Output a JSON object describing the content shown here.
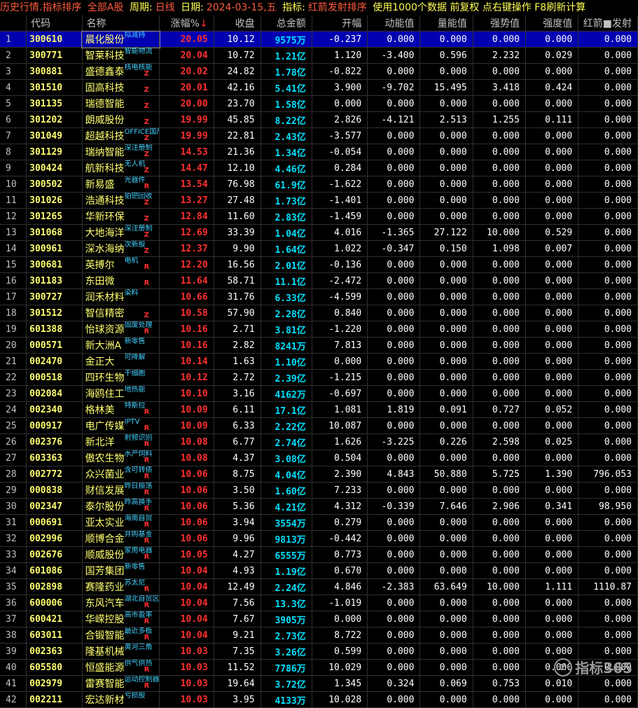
{
  "title": {
    "main": "历史行情.指标排序",
    "market": "全部A股",
    "period_label": "周期:",
    "period_value": "日线",
    "date_label": "日期:",
    "date_value": "2024-03-15,五",
    "indicator_label": "指标:",
    "indicator_value": "红箭发射排序",
    "note": "使用1000个数据 前复权 点右键操作 F8刷新计算"
  },
  "columns": [
    "",
    "代码",
    "名称",
    "涨幅%",
    "收盘",
    "总金额",
    "开幅",
    "动能值",
    "量能值",
    "强势值",
    "强度值",
    "红箭■发射"
  ],
  "sort_arrow": "↓",
  "rows": [
    {
      "i": "1",
      "code": "300610",
      "name": "晨化股份",
      "tag": "拟减持",
      "mark": "",
      "chg": "20.05",
      "close": "10.12",
      "amt": "9575",
      "unit": "万",
      "open": "-0.237",
      "dn": "0.000",
      "ln": "0.000",
      "qs": "0.000",
      "qd": "0.000",
      "hj": "0.000"
    },
    {
      "i": "2",
      "code": "300771",
      "name": "智莱科技",
      "tag": "智能物流",
      "mark": "",
      "chg": "20.04",
      "close": "10.72",
      "amt": "1.21",
      "unit": "亿",
      "open": "1.120",
      "dn": "-3.400",
      "ln": "0.596",
      "qs": "2.232",
      "qd": "0.029",
      "hj": "0.000"
    },
    {
      "i": "3",
      "code": "300881",
      "name": "盛德鑫泰",
      "tag": "核电核能",
      "mark": "Z",
      "chg": "20.02",
      "close": "24.82",
      "amt": "1.78",
      "unit": "亿",
      "open": "-0.822",
      "dn": "0.000",
      "ln": "0.000",
      "qs": "0.000",
      "qd": "0.000",
      "hj": "0.000"
    },
    {
      "i": "4",
      "code": "301510",
      "name": "固高科技",
      "tag": "",
      "mark": "Z",
      "chg": "20.01",
      "close": "42.16",
      "amt": "5.41",
      "unit": "亿",
      "open": "3.900",
      "dn": "-9.702",
      "ln": "15.495",
      "qs": "3.418",
      "qd": "0.424",
      "hj": "0.000"
    },
    {
      "i": "5",
      "code": "301135",
      "name": "瑞德智能",
      "tag": "",
      "mark": "Z",
      "chg": "20.00",
      "close": "23.70",
      "amt": "1.58",
      "unit": "亿",
      "open": "0.000",
      "dn": "0.000",
      "ln": "0.000",
      "qs": "0.000",
      "qd": "0.000",
      "hj": "0.000"
    },
    {
      "i": "6",
      "code": "301202",
      "name": "朗威股份",
      "tag": "",
      "mark": "Z",
      "chg": "19.99",
      "close": "45.85",
      "amt": "8.22",
      "unit": "亿",
      "open": "2.826",
      "dn": "-4.121",
      "ln": "2.513",
      "qs": "1.255",
      "qd": "0.111",
      "hj": "0.000"
    },
    {
      "i": "7",
      "code": "301049",
      "name": "超越科技",
      "tag": "OFFICE国产",
      "mark": "Z",
      "chg": "19.99",
      "close": "22.81",
      "amt": "2.43",
      "unit": "亿",
      "open": "-3.577",
      "dn": "0.000",
      "ln": "0.000",
      "qs": "0.000",
      "qd": "0.000",
      "hj": "0.000"
    },
    {
      "i": "8",
      "code": "301129",
      "name": "瑞纳智能",
      "tag": "深注册制",
      "mark": "Z",
      "chg": "14.53",
      "close": "21.36",
      "amt": "1.34",
      "unit": "亿",
      "open": "-0.054",
      "dn": "0.000",
      "ln": "0.000",
      "qs": "0.000",
      "qd": "0.000",
      "hj": "0.000"
    },
    {
      "i": "9",
      "code": "300424",
      "name": "航新科技",
      "tag": "无人机",
      "mark": "Z",
      "chg": "14.47",
      "close": "12.10",
      "amt": "4.46",
      "unit": "亿",
      "open": "0.284",
      "dn": "0.000",
      "ln": "0.000",
      "qs": "0.000",
      "qd": "0.000",
      "hj": "0.000"
    },
    {
      "i": "10",
      "code": "300502",
      "name": "新易盛",
      "tag": "光器件",
      "mark": "R",
      "chg": "13.54",
      "close": "76.98",
      "amt": "61.9",
      "unit": "亿",
      "open": "-1.622",
      "dn": "0.000",
      "ln": "0.000",
      "qs": "0.000",
      "qd": "0.000",
      "hj": "0.000"
    },
    {
      "i": "11",
      "code": "301026",
      "name": "浩通科技",
      "tag": "铂钯回收",
      "mark": "Z",
      "chg": "13.27",
      "close": "27.48",
      "amt": "1.73",
      "unit": "亿",
      "open": "-1.401",
      "dn": "0.000",
      "ln": "0.000",
      "qs": "0.000",
      "qd": "0.000",
      "hj": "0.000"
    },
    {
      "i": "12",
      "code": "301265",
      "name": "华新环保",
      "tag": "",
      "mark": "Z",
      "chg": "12.84",
      "close": "11.60",
      "amt": "2.83",
      "unit": "亿",
      "open": "-1.459",
      "dn": "0.000",
      "ln": "0.000",
      "qs": "0.000",
      "qd": "0.000",
      "hj": "0.000"
    },
    {
      "i": "13",
      "code": "301068",
      "name": "大地海洋",
      "tag": "深注册制",
      "mark": "Z",
      "chg": "12.69",
      "close": "33.39",
      "amt": "1.04",
      "unit": "亿",
      "open": "4.016",
      "dn": "-1.365",
      "ln": "27.122",
      "qs": "10.000",
      "qd": "0.529",
      "hj": "0.000"
    },
    {
      "i": "14",
      "code": "300961",
      "name": "深水海纳",
      "tag": "次新股",
      "mark": "Z",
      "chg": "12.37",
      "close": "9.90",
      "amt": "1.64",
      "unit": "亿",
      "open": "1.022",
      "dn": "-0.347",
      "ln": "0.150",
      "qs": "1.098",
      "qd": "0.007",
      "hj": "0.000"
    },
    {
      "i": "15",
      "code": "300681",
      "name": "英搏尔",
      "tag": "电机",
      "mark": "R",
      "chg": "12.20",
      "close": "16.56",
      "amt": "2.01",
      "unit": "亿",
      "open": "-0.136",
      "dn": "0.000",
      "ln": "0.000",
      "qs": "0.000",
      "qd": "0.000",
      "hj": "0.000"
    },
    {
      "i": "16",
      "code": "301183",
      "name": "东田微",
      "tag": "",
      "mark": "R",
      "chg": "11.64",
      "close": "58.71",
      "amt": "11.1",
      "unit": "亿",
      "open": "-2.472",
      "dn": "0.000",
      "ln": "0.000",
      "qs": "0.000",
      "qd": "0.000",
      "hj": "0.000"
    },
    {
      "i": "17",
      "code": "300727",
      "name": "润禾材料",
      "tag": "染料",
      "mark": "",
      "chg": "10.66",
      "close": "31.76",
      "amt": "6.33",
      "unit": "亿",
      "open": "-4.599",
      "dn": "0.000",
      "ln": "0.000",
      "qs": "0.000",
      "qd": "0.000",
      "hj": "0.000"
    },
    {
      "i": "18",
      "code": "301512",
      "name": "智信精密",
      "tag": "",
      "mark": "Z",
      "chg": "10.58",
      "close": "57.90",
      "amt": "2.28",
      "unit": "亿",
      "open": "0.840",
      "dn": "0.000",
      "ln": "0.000",
      "qs": "0.000",
      "qd": "0.000",
      "hj": "0.000"
    },
    {
      "i": "19",
      "code": "601388",
      "name": "怡球资源",
      "tag": "固废处理",
      "mark": "R",
      "chg": "10.16",
      "close": "2.71",
      "amt": "3.81",
      "unit": "亿",
      "open": "-1.220",
      "dn": "0.000",
      "ln": "0.000",
      "qs": "0.000",
      "qd": "0.000",
      "hj": "0.000"
    },
    {
      "i": "20",
      "code": "000571",
      "name": "新大洲A",
      "tag": "新零售",
      "mark": "",
      "chg": "10.16",
      "close": "2.82",
      "amt": "8241",
      "unit": "万",
      "open": "7.813",
      "dn": "0.000",
      "ln": "0.000",
      "qs": "0.000",
      "qd": "0.000",
      "hj": "0.000"
    },
    {
      "i": "21",
      "code": "002470",
      "name": "金正大",
      "tag": "可降解",
      "mark": "",
      "chg": "10.14",
      "close": "1.63",
      "amt": "1.10",
      "unit": "亿",
      "open": "0.000",
      "dn": "0.000",
      "ln": "0.000",
      "qs": "0.000",
      "qd": "0.000",
      "hj": "0.000"
    },
    {
      "i": "22",
      "code": "000518",
      "name": "四环生物",
      "tag": "干细胞",
      "mark": "",
      "chg": "10.12",
      "close": "2.72",
      "amt": "2.39",
      "unit": "亿",
      "open": "-1.215",
      "dn": "0.000",
      "ln": "0.000",
      "qs": "0.000",
      "qd": "0.000",
      "hj": "0.000"
    },
    {
      "i": "23",
      "code": "002084",
      "name": "海鸥住工",
      "tag": "地热能",
      "mark": "",
      "chg": "10.10",
      "close": "3.16",
      "amt": "4162",
      "unit": "万",
      "open": "-0.697",
      "dn": "0.000",
      "ln": "0.000",
      "qs": "0.000",
      "qd": "0.000",
      "hj": "0.000"
    },
    {
      "i": "24",
      "code": "002340",
      "name": "格林美",
      "tag": "特斯拉",
      "mark": "R",
      "chg": "10.09",
      "close": "6.11",
      "amt": "17.1",
      "unit": "亿",
      "open": "1.081",
      "dn": "1.819",
      "ln": "0.091",
      "qs": "0.727",
      "qd": "0.052",
      "hj": "0.000"
    },
    {
      "i": "25",
      "code": "000917",
      "name": "电广传媒",
      "tag": "IPTV",
      "mark": "R",
      "chg": "10.09",
      "close": "6.33",
      "amt": "2.22",
      "unit": "亿",
      "open": "10.087",
      "dn": "0.000",
      "ln": "0.000",
      "qs": "0.000",
      "qd": "0.000",
      "hj": "0.000"
    },
    {
      "i": "26",
      "code": "002376",
      "name": "新北洋",
      "tag": "射频识别",
      "mark": "R",
      "chg": "10.08",
      "close": "6.77",
      "amt": "2.74",
      "unit": "亿",
      "open": "1.626",
      "dn": "-3.225",
      "ln": "0.226",
      "qs": "2.598",
      "qd": "0.025",
      "hj": "0.000"
    },
    {
      "i": "27",
      "code": "603363",
      "name": "傲农生物",
      "tag": "水产饲料",
      "mark": "R",
      "chg": "10.08",
      "close": "4.37",
      "amt": "3.08",
      "unit": "亿",
      "open": "0.504",
      "dn": "0.000",
      "ln": "0.000",
      "qs": "0.000",
      "qd": "0.000",
      "hj": "0.000"
    },
    {
      "i": "28",
      "code": "002772",
      "name": "众兴菌业",
      "tag": "含可转债",
      "mark": "R",
      "chg": "10.06",
      "close": "8.75",
      "amt": "4.04",
      "unit": "亿",
      "open": "2.390",
      "dn": "4.843",
      "ln": "50.880",
      "qs": "5.725",
      "qd": "1.390",
      "hj": "796.053"
    },
    {
      "i": "29",
      "code": "000838",
      "name": "财信发展",
      "tag": "昨日振荡",
      "mark": "R",
      "chg": "10.06",
      "close": "3.50",
      "amt": "1.60",
      "unit": "亿",
      "open": "7.233",
      "dn": "0.000",
      "ln": "0.000",
      "qs": "0.000",
      "qd": "0.000",
      "hj": "0.000"
    },
    {
      "i": "30",
      "code": "002347",
      "name": "泰尔股份",
      "tag": "昨高换手",
      "mark": "R",
      "chg": "10.06",
      "close": "5.36",
      "amt": "4.21",
      "unit": "亿",
      "open": "4.312",
      "dn": "-0.339",
      "ln": "7.646",
      "qs": "2.906",
      "qd": "0.341",
      "hj": "98.950"
    },
    {
      "i": "31",
      "code": "000691",
      "name": "亚太实业",
      "tag": "海南自贸",
      "mark": "R",
      "chg": "10.06",
      "close": "3.94",
      "amt": "3554",
      "unit": "万",
      "open": "0.279",
      "dn": "0.000",
      "ln": "0.000",
      "qs": "0.000",
      "qd": "0.000",
      "hj": "0.000"
    },
    {
      "i": "32",
      "code": "002996",
      "name": "顺博合金",
      "tag": "并购基金",
      "mark": "R",
      "chg": "10.06",
      "close": "9.96",
      "amt": "9813",
      "unit": "万",
      "open": "-0.442",
      "dn": "0.000",
      "ln": "0.000",
      "qs": "0.000",
      "qd": "0.000",
      "hj": "0.000"
    },
    {
      "i": "33",
      "code": "002676",
      "name": "顺威股份",
      "tag": "家用电器",
      "mark": "R",
      "chg": "10.05",
      "close": "4.27",
      "amt": "6555",
      "unit": "万",
      "open": "0.773",
      "dn": "0.000",
      "ln": "0.000",
      "qs": "0.000",
      "qd": "0.000",
      "hj": "0.000"
    },
    {
      "i": "34",
      "code": "601086",
      "name": "国芳集团",
      "tag": "新零售",
      "mark": "",
      "chg": "10.04",
      "close": "4.93",
      "amt": "1.19",
      "unit": "亿",
      "open": "0.670",
      "dn": "0.000",
      "ln": "0.000",
      "qs": "0.000",
      "qd": "0.000",
      "hj": "0.000"
    },
    {
      "i": "35",
      "code": "002898",
      "name": "赛隆药业",
      "tag": "苏太尼",
      "mark": "R",
      "chg": "10.04",
      "close": "12.49",
      "amt": "2.24",
      "unit": "亿",
      "open": "4.846",
      "dn": "-2.383",
      "ln": "63.649",
      "qs": "10.000",
      "qd": "1.111",
      "hj": "1110.87"
    },
    {
      "i": "36",
      "code": "600006",
      "name": "东风汽车",
      "tag": "湖北自贸区",
      "mark": "R",
      "chg": "10.04",
      "close": "7.56",
      "amt": "13.3",
      "unit": "亿",
      "open": "-1.019",
      "dn": "0.000",
      "ln": "0.000",
      "qs": "0.000",
      "qd": "0.000",
      "hj": "0.000"
    },
    {
      "i": "37",
      "code": "600421",
      "name": "华嵘控股",
      "tag": "高市盈率",
      "mark": "R",
      "chg": "10.04",
      "close": "7.67",
      "amt": "3905",
      "unit": "万",
      "open": "0.000",
      "dn": "0.000",
      "ln": "0.000",
      "qs": "0.000",
      "qd": "0.000",
      "hj": "0.000"
    },
    {
      "i": "38",
      "code": "603011",
      "name": "合锻智能",
      "tag": "最近多板",
      "mark": "R",
      "chg": "10.04",
      "close": "9.21",
      "amt": "2.73",
      "unit": "亿",
      "open": "8.722",
      "dn": "0.000",
      "ln": "0.000",
      "qs": "0.000",
      "qd": "0.000",
      "hj": "0.000"
    },
    {
      "i": "39",
      "code": "002363",
      "name": "隆基机械",
      "tag": "黄河三角",
      "mark": "",
      "chg": "10.03",
      "close": "7.35",
      "amt": "3.26",
      "unit": "亿",
      "open": "0.599",
      "dn": "0.000",
      "ln": "0.000",
      "qs": "0.000",
      "qd": "0.000",
      "hj": "0.000"
    },
    {
      "i": "40",
      "code": "605580",
      "name": "恒盛能源",
      "tag": "供气供热",
      "mark": "R",
      "chg": "10.03",
      "close": "11.52",
      "amt": "7786",
      "unit": "万",
      "open": "10.029",
      "dn": "0.000",
      "ln": "0.000",
      "qs": "0.000",
      "qd": "0.000",
      "hj": "0.000"
    },
    {
      "i": "41",
      "code": "002979",
      "name": "雷赛智能",
      "tag": "运动控制器",
      "mark": "R",
      "chg": "10.03",
      "close": "19.64",
      "amt": "3.72",
      "unit": "亿",
      "open": "1.345",
      "dn": "0.324",
      "ln": "0.069",
      "qs": "0.753",
      "qd": "0.010",
      "hj": "0.000"
    },
    {
      "i": "42",
      "code": "002211",
      "name": "宏达新材",
      "tag": "亏损股",
      "mark": "",
      "chg": "10.03",
      "close": "3.95",
      "amt": "4133",
      "unit": "万",
      "open": "10.028",
      "dn": "0.000",
      "ln": "0.000",
      "qs": "0.000",
      "qd": "0.000",
      "hj": "0.000"
    }
  ],
  "watermark": "指标365",
  "watermark_logo": "Z"
}
